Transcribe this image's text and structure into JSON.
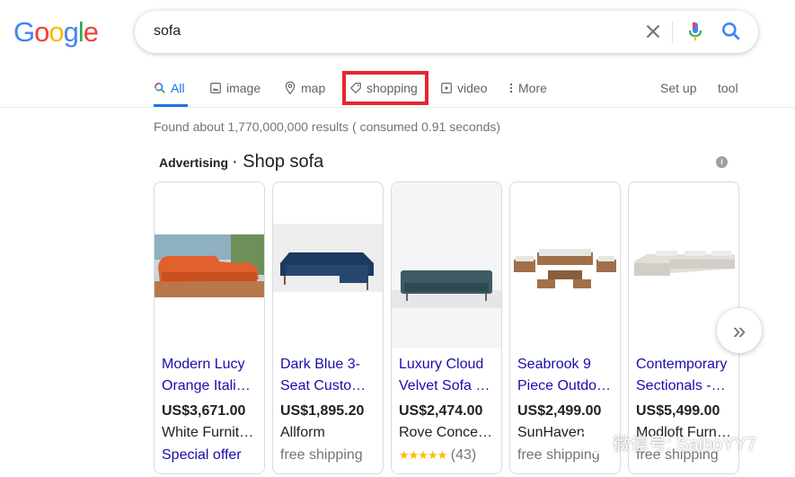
{
  "logo": {
    "letters": [
      "G",
      "o",
      "o",
      "g",
      "l",
      "e"
    ],
    "colors": [
      "#4285f4",
      "#ea4335",
      "#fbbc05",
      "#4285f4",
      "#34a853",
      "#ea4335"
    ]
  },
  "search": {
    "query": "sofa"
  },
  "tabs": [
    {
      "label": "All",
      "icon": "search-icon",
      "active": true
    },
    {
      "label": "image",
      "icon": "image-icon"
    },
    {
      "label": "map",
      "icon": "map-pin-icon"
    },
    {
      "label": "shopping",
      "icon": "tag-icon"
    },
    {
      "label": "video",
      "icon": "play-icon"
    },
    {
      "label": "More",
      "icon": "kebab-icon"
    }
  ],
  "settings": {
    "setup": "Set up",
    "tool": "tool"
  },
  "results_stats": "Found about 1,770,000,000 results ( consumed 0.91 seconds)",
  "ads": {
    "label": "Advertising",
    "title": "· Shop sofa",
    "info": "i",
    "products": [
      {
        "title1": "Modern Lucy",
        "title2": "Orange Itali…",
        "price": "US$3,671.00",
        "seller": "White Furnit…",
        "extra": "Special offer"
      },
      {
        "title1": "Dark Blue 3-",
        "title2": "Seat Custo…",
        "price": "US$1,895.20",
        "seller": "Allform",
        "extra": "free shipping"
      },
      {
        "title1": "Luxury Cloud",
        "title2": "Velvet Sofa …",
        "price": "US$2,474.00",
        "seller": "Rove Conce…",
        "rating_stars": "★★★★★",
        "rating_count": "(43)"
      },
      {
        "title1": "Seabrook 9",
        "title2": "Piece Outdo…",
        "price": "US$2,499.00",
        "seller": "SunHaven",
        "extra": "free shipping"
      },
      {
        "title1": "Contemporary",
        "title2": "Sectionals -…",
        "price": "US$5,499.00",
        "seller": "Modloft Furn…",
        "extra": "free shipping"
      }
    ],
    "next": "»"
  },
  "watermark": "微信号: SaiboYY7",
  "colors": {
    "accent": "#1a73e8",
    "link": "#1a0dab",
    "highlight": "#e6262f",
    "star": "#fbbc04"
  }
}
